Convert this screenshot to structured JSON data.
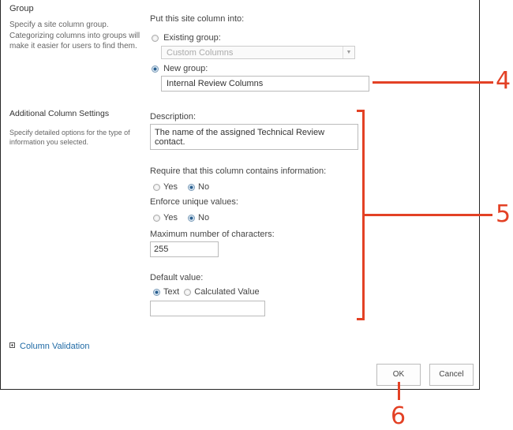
{
  "group_section": {
    "title": "Group",
    "description_lines": [
      "Specify a site column group.",
      "Categorizing columns into groups will",
      "make it easier for users to find them."
    ],
    "put_into_label": "Put this site column into:",
    "existing_group_label": "Existing group:",
    "existing_group_selected": false,
    "existing_group_value": "Custom Columns",
    "new_group_label": "New group:",
    "new_group_selected": true,
    "new_group_value": "Internal Review Columns"
  },
  "additional_section": {
    "title": "Additional Column Settings",
    "description_lines": [
      "Specify detailed options for the type of",
      "information you selected."
    ],
    "description_label": "Description:",
    "description_value": "The name of the assigned Technical Review contact.",
    "require_label": "Require that this column contains information:",
    "require_options": [
      {
        "label": "Yes",
        "selected": false
      },
      {
        "label": "No",
        "selected": true
      }
    ],
    "unique_label": "Enforce unique values:",
    "unique_options": [
      {
        "label": "Yes",
        "selected": false
      },
      {
        "label": "No",
        "selected": true
      }
    ],
    "max_chars_label": "Maximum number of characters:",
    "max_chars_value": "255",
    "default_value_label": "Default value:",
    "default_options": [
      {
        "label": "Text",
        "selected": true
      },
      {
        "label": "Calculated Value",
        "selected": false
      }
    ],
    "default_value": ""
  },
  "column_validation_link": "Column Validation",
  "buttons": {
    "ok": "OK",
    "cancel": "Cancel"
  },
  "callouts": {
    "c4": "4",
    "c5": "5",
    "c6": "6",
    "color": "#e34125"
  }
}
